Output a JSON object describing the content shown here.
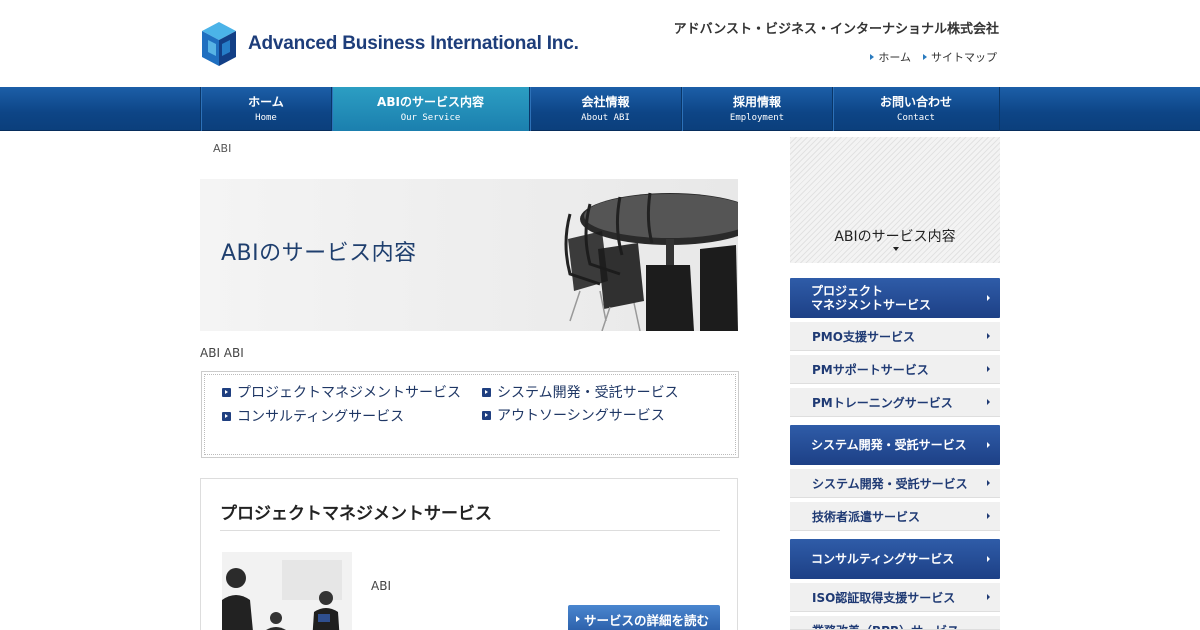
{
  "header": {
    "logo_text": "Advanced Business International Inc.",
    "company_name": "アドバンスト・ビジネス・インターナショナル株式会社",
    "top_links": [
      "ホーム",
      "サイトマップ"
    ]
  },
  "nav": {
    "items": [
      {
        "jp": "ホーム",
        "en": "Home"
      },
      {
        "jp": "ABIのサービス内容",
        "en": "Our Service"
      },
      {
        "jp": "会社情報",
        "en": "About ABI"
      },
      {
        "jp": "採用情報",
        "en": "Employment"
      },
      {
        "jp": "お問い合わせ",
        "en": "Contact"
      }
    ],
    "active_index": 1
  },
  "breadcrumb": "ABI",
  "hero": {
    "title": "ABIのサービス内容"
  },
  "intro": "ABI ABI",
  "anchor_links": [
    "プロジェクトマネジメントサービス",
    "システム開発・受託サービス",
    "コンサルティングサービス",
    "アウトソーシングサービス"
  ],
  "section": {
    "title": "プロジェクトマネジメントサービス",
    "text": "ABI",
    "button": "サービスの詳細を読む"
  },
  "sidebar": {
    "heading": "ABIのサービス内容",
    "groups": [
      {
        "title": "プロジェクト\nマネジメントサービス",
        "items": [
          "PMO支援サービス",
          "PMサポートサービス",
          "PMトレーニングサービス"
        ]
      },
      {
        "title": "システム開発・受託サービス",
        "items": [
          "システム開発・受託サービス",
          "技術者派遣サービス"
        ]
      },
      {
        "title": "コンサルティングサービス",
        "items": [
          "ISO認証取得支援サービス",
          "業務改善（BPR）サービス"
        ]
      }
    ]
  },
  "colors": {
    "nav": "#0d4586",
    "nav_active": "#1b7fae",
    "accent": "#1f3f80",
    "sidebar_cat": "#2f5ca8"
  }
}
